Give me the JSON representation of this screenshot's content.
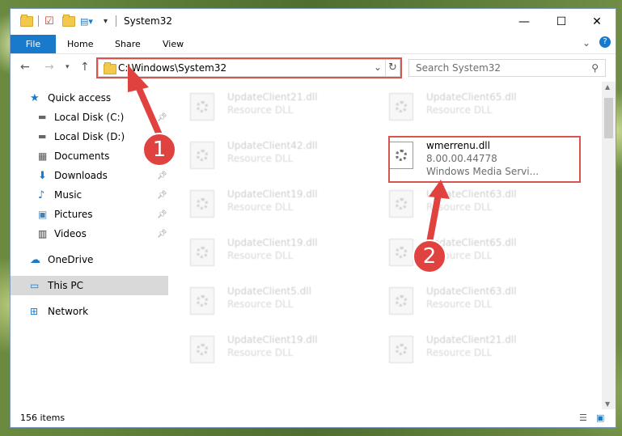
{
  "window": {
    "title": "System32",
    "minimize_glyph": "—",
    "maximize_glyph": "☐",
    "close_glyph": "✕"
  },
  "ribbon": {
    "file_label": "File",
    "tabs": [
      "Home",
      "Share",
      "View"
    ]
  },
  "address": {
    "path": "C:\\Windows\\System32",
    "search_placeholder": "Search System32"
  },
  "sidebar": {
    "items": [
      {
        "label": "Quick access",
        "icon": "star-icon"
      },
      {
        "label": "Local Disk (C:)",
        "icon": "drive-icon",
        "pinned": true
      },
      {
        "label": "Local Disk (D:)",
        "icon": "drive-icon"
      },
      {
        "label": "Documents",
        "icon": "documents-icon",
        "pinned": true
      },
      {
        "label": "Downloads",
        "icon": "download-icon",
        "pinned": true
      },
      {
        "label": "Music",
        "icon": "music-icon",
        "pinned": true
      },
      {
        "label": "Pictures",
        "icon": "pictures-icon",
        "pinned": true
      },
      {
        "label": "Videos",
        "icon": "videos-icon",
        "pinned": true
      },
      {
        "label": "OneDrive",
        "icon": "cloud-icon"
      },
      {
        "label": "This PC",
        "icon": "computer-icon",
        "selected": true
      },
      {
        "label": "Network",
        "icon": "network-icon"
      }
    ]
  },
  "files": {
    "left": [
      {
        "name": "UpdateClient21.dll",
        "desc": "Resource DLL"
      },
      {
        "name": "UpdateClient42.dll",
        "desc": "Resource DLL"
      },
      {
        "name": "UpdateClient19.dll",
        "desc": "Resource DLL"
      },
      {
        "name": "UpdateClient19.dll",
        "desc": "Resource DLL"
      },
      {
        "name": "UpdateClient5.dll",
        "desc": "Resource DLL"
      },
      {
        "name": "UpdateClient19.dll",
        "desc": "Resource DLL"
      }
    ],
    "right": [
      {
        "name": "UpdateClient65.dll",
        "desc": "Resource DLL"
      },
      {
        "name": "wmerrenu.dll",
        "desc": "8.00.00.44778",
        "desc2": "Windows Media Servi..."
      },
      {
        "name": "UpdateClient63.dll",
        "desc": "Resource DLL"
      },
      {
        "name": "UpdateClient65.dll",
        "desc": "Resource DLL"
      },
      {
        "name": "UpdateClient63.dll",
        "desc": "Resource DLL"
      },
      {
        "name": "UpdateClient21.dll",
        "desc": "Resource DLL"
      }
    ]
  },
  "status": {
    "item_count": "156 items"
  },
  "annotations": {
    "step1": "1",
    "step2": "2",
    "color": "#e0433f"
  }
}
